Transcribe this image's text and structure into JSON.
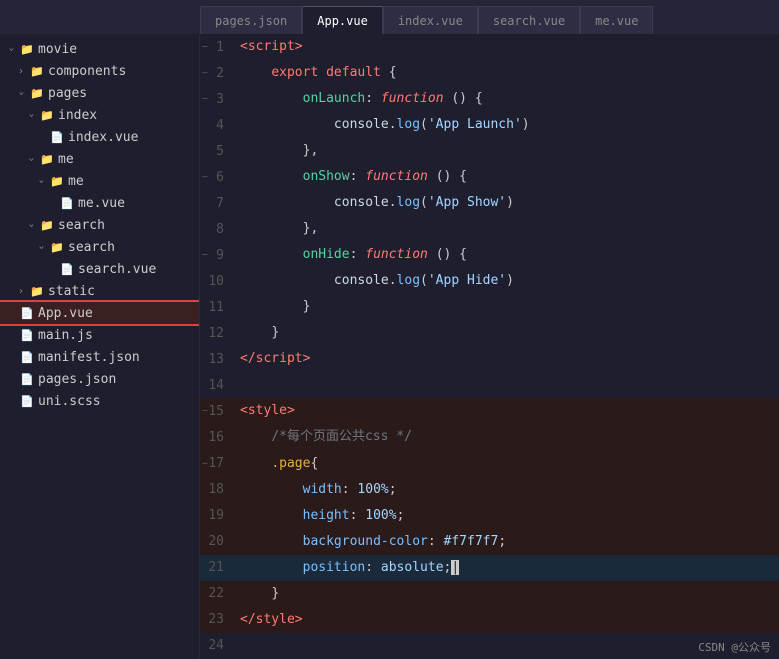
{
  "tabs": [
    {
      "label": "pages.json",
      "active": false
    },
    {
      "label": "App.vue",
      "active": true
    },
    {
      "label": "index.vue",
      "active": false
    },
    {
      "label": "search.vue",
      "active": false
    },
    {
      "label": "me.vue",
      "active": false
    }
  ],
  "sidebar": {
    "title": "movie",
    "items": [
      {
        "id": "movie",
        "label": "movie",
        "level": 1,
        "type": "folder",
        "open": true
      },
      {
        "id": "components",
        "label": "components",
        "level": 2,
        "type": "folder",
        "open": false
      },
      {
        "id": "pages",
        "label": "pages",
        "level": 2,
        "type": "folder",
        "open": true
      },
      {
        "id": "index-folder",
        "label": "index",
        "level": 3,
        "type": "folder",
        "open": true
      },
      {
        "id": "index-vue",
        "label": "index.vue",
        "level": 4,
        "type": "file"
      },
      {
        "id": "me-folder",
        "label": "me",
        "level": 3,
        "type": "folder",
        "open": true
      },
      {
        "id": "me-subfolder",
        "label": "me",
        "level": 4,
        "type": "folder",
        "open": true
      },
      {
        "id": "me-vue",
        "label": "me.vue",
        "level": 5,
        "type": "file"
      },
      {
        "id": "search-folder",
        "label": "search",
        "level": 3,
        "type": "folder",
        "open": true
      },
      {
        "id": "search-subfolder",
        "label": "search",
        "level": 4,
        "type": "folder",
        "open": true
      },
      {
        "id": "search-vue",
        "label": "search.vue",
        "level": 5,
        "type": "file"
      },
      {
        "id": "static-folder",
        "label": "static",
        "level": 2,
        "type": "folder",
        "open": false
      },
      {
        "id": "app-vue",
        "label": "App.vue",
        "level": 1,
        "type": "file",
        "selected": true
      },
      {
        "id": "main-js",
        "label": "main.js",
        "level": 1,
        "type": "file"
      },
      {
        "id": "manifest-json",
        "label": "manifest.json",
        "level": 1,
        "type": "file"
      },
      {
        "id": "pages-json",
        "label": "pages.json",
        "level": 1,
        "type": "file"
      },
      {
        "id": "uni-scss",
        "label": "uni.scss",
        "level": 1,
        "type": "file"
      }
    ]
  },
  "watermark": "CSDN @公众号"
}
